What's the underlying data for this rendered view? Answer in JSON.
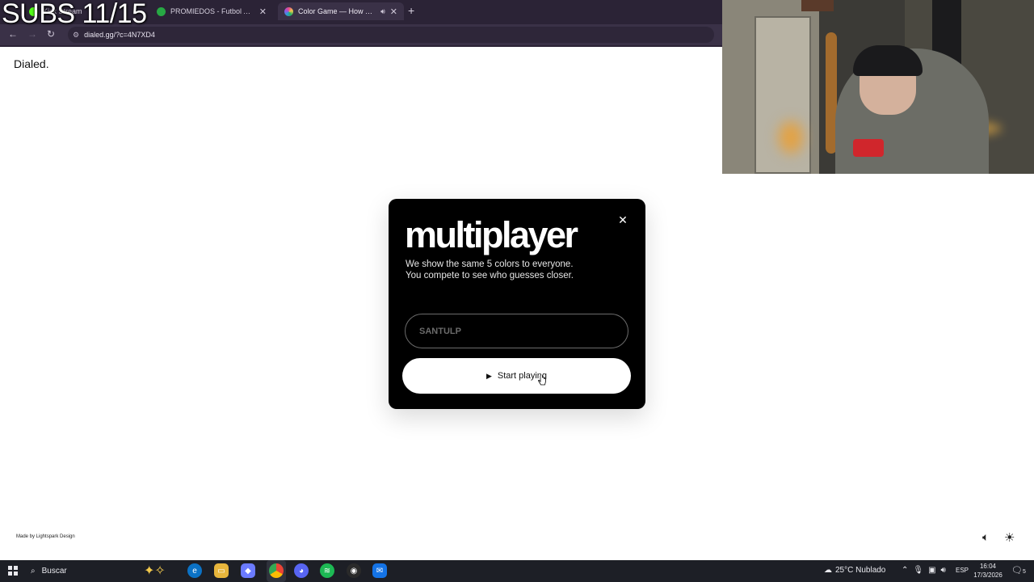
{
  "overlay": {
    "subs_text": "SUBS 11/15"
  },
  "browser": {
    "tabs": [
      {
        "title": "Kick Stream",
        "favicon_color": "#53fc18",
        "active": false
      },
      {
        "title": "PROMIEDOS - Futbol Argentino",
        "favicon_color": "#27a844",
        "active": false
      },
      {
        "title": "Color Game — How Well Can You See Color?",
        "favicon_color": "#e84d8a",
        "active": true
      }
    ],
    "new_tab_icon": "+",
    "url": "dialed.gg/?c=4N7XD4"
  },
  "page": {
    "brand": "Dialed.",
    "credit": "Made by Lightspark Design"
  },
  "modal": {
    "title": "multiplayer",
    "description_line1": "We show the same 5 colors to everyone.",
    "description_line2": "You compete to see who guesses closer.",
    "name_placeholder": "SANTULP",
    "start_label": "Start playing",
    "close_icon": "close-icon"
  },
  "taskbar": {
    "search_label": "Buscar",
    "weather": "25°C  Nublado",
    "language": "ESP",
    "time": "16:04",
    "date": "17/3/2026",
    "notifications_count": "5"
  }
}
